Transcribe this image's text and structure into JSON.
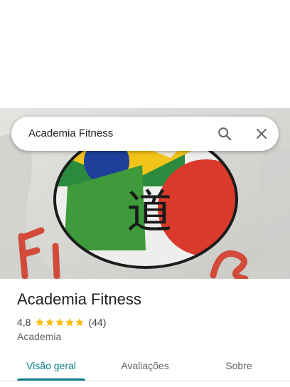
{
  "search": {
    "query": "Academia Fitness"
  },
  "place": {
    "name": "Academia Fitness",
    "rating": "4,8",
    "stars": 5,
    "review_count": "(44)",
    "category": "Academia"
  },
  "tabs": [
    {
      "label": "Visão geral",
      "selected": true
    },
    {
      "label": "Avaliações",
      "selected": false
    },
    {
      "label": "Sobre",
      "selected": false
    }
  ],
  "colors": {
    "accent": "#0b7e8c",
    "star": "#fbbc04"
  },
  "icons": {
    "search": "search-icon",
    "close": "close-icon",
    "star": "star-icon"
  },
  "hero_image": {
    "emblem_glyph": "道"
  }
}
